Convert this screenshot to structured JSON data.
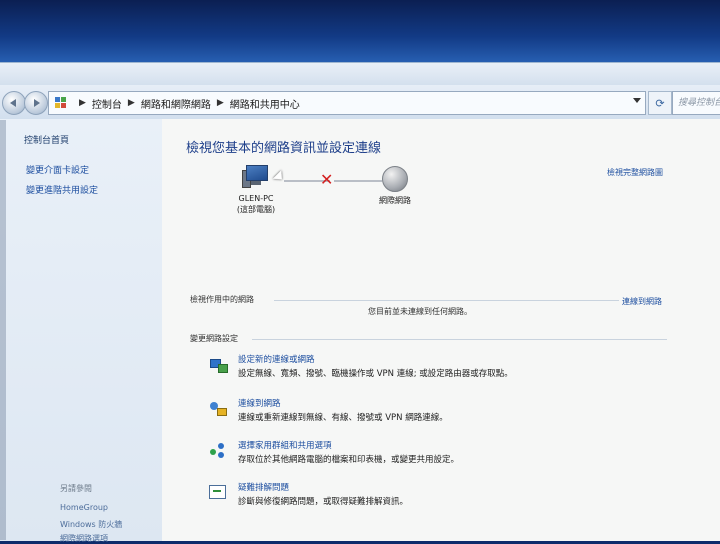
{
  "search": {
    "placeholder": "搜尋控制台"
  },
  "breadcrumb": [
    "控制台",
    "網路和網際網路",
    "網路和共用中心"
  ],
  "sidebar": {
    "title": "控制台首頁",
    "links": [
      "變更介面卡設定",
      "變更進階共用設定"
    ],
    "see_also": "另請參閱",
    "bottom_links": [
      "HomeGroup",
      "Windows 防火牆",
      "網際網路選項"
    ]
  },
  "main": {
    "title": "檢視您基本的網路資訊並設定連線",
    "view_full_map": "檢視完整網路圖",
    "computer": {
      "name": "GLEN-PC",
      "sub": "(這部電腦)"
    },
    "internet_label": "網際網路",
    "active_networks": {
      "heading": "檢視作用中的網路",
      "connect_link": "連線到網路",
      "status": "您目前並未連線到任何網路。"
    },
    "change_settings": {
      "heading": "變更網路設定",
      "tasks": [
        {
          "icon": "network-setup-icon",
          "title": "設定新的連線或網路",
          "desc": "設定無線、寬頻、撥號、臨機操作或 VPN 連線; 或設定路由器或存取點。"
        },
        {
          "icon": "connect-network-icon",
          "title": "連線到網路",
          "desc": "連線或重新連線到無線、有線、撥號或 VPN 網路連線。"
        },
        {
          "icon": "homegroup-icon",
          "title": "選擇家用群組和共用選項",
          "desc": "存取位於其他網路電腦的檔案和印表機，或變更共用設定。"
        },
        {
          "icon": "troubleshoot-icon",
          "title": "疑難排解問題",
          "desc": "診斷與修復網路問題，或取得疑難排解資訊。"
        }
      ]
    }
  },
  "colors": {
    "link": "#1e4fa0",
    "title": "#1e3f8a",
    "error_x": "#d42020"
  }
}
